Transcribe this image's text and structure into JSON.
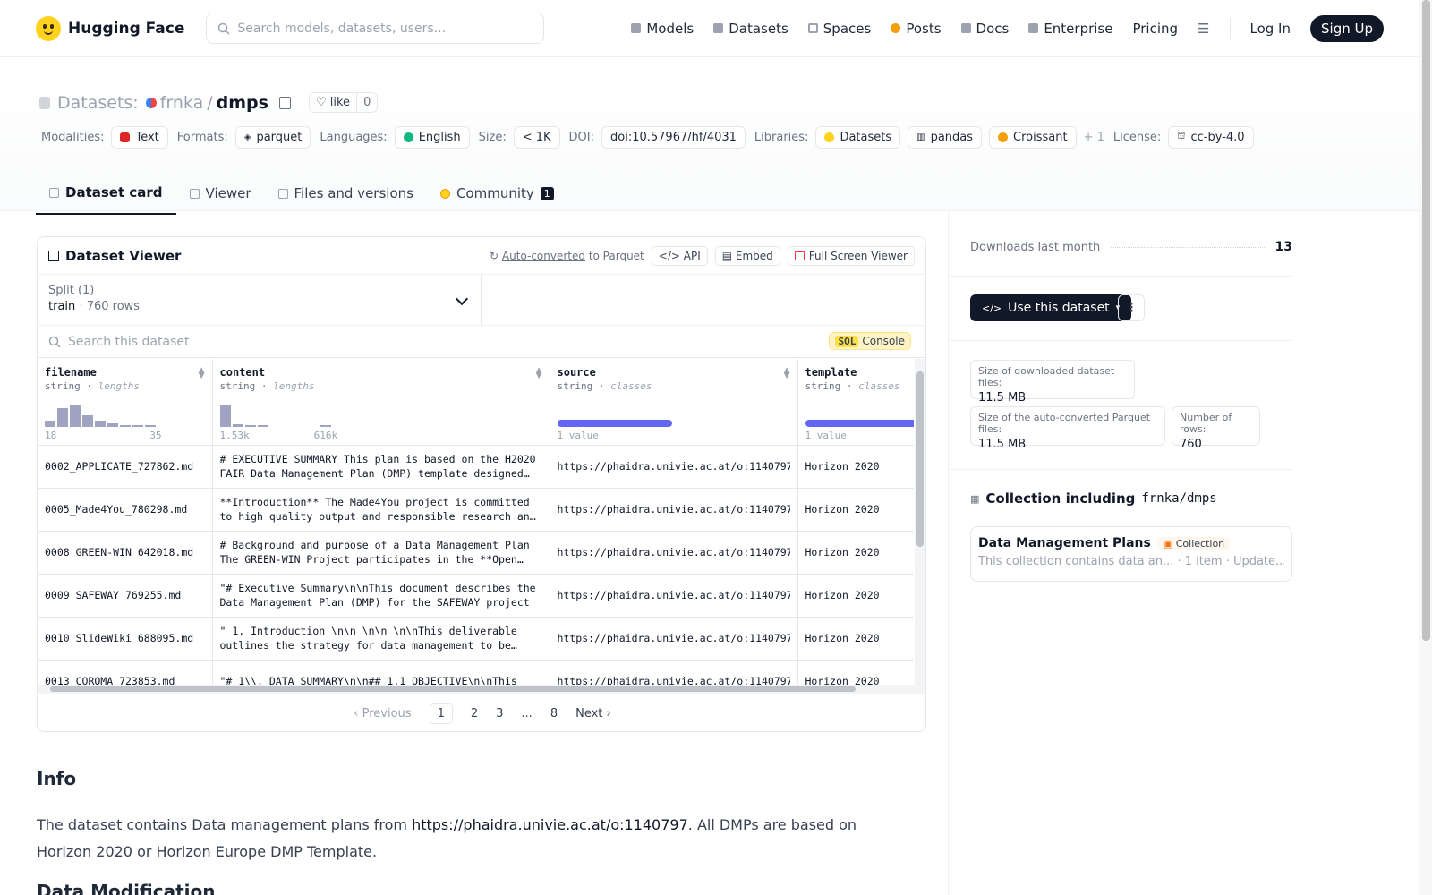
{
  "nav": {
    "brand": "Hugging Face",
    "search_placeholder": "Search models, datasets, users...",
    "links": [
      "Models",
      "Datasets",
      "Spaces",
      "Posts",
      "Docs",
      "Enterprise",
      "Pricing"
    ],
    "login": "Log In",
    "signup": "Sign Up"
  },
  "header": {
    "section": "Datasets:",
    "owner": "frnka",
    "sep": "/",
    "name": "dmps",
    "like_label": "like",
    "like_count": "0"
  },
  "meta": {
    "modalities_label": "Modalities:",
    "modality": "Text",
    "formats_label": "Formats:",
    "format": "parquet",
    "languages_label": "Languages:",
    "language": "English",
    "size_label": "Size:",
    "size": "< 1K",
    "doi_label": "DOI:",
    "doi": "doi:10.57967/hf/4031",
    "libraries_label": "Libraries:",
    "libraries": [
      "Datasets",
      "pandas",
      "Croissant"
    ],
    "libraries_more": "+ 1",
    "license_label": "License:",
    "license": "cc-by-4.0"
  },
  "tabs": [
    "Dataset card",
    "Viewer",
    "Files and versions",
    "Community"
  ],
  "community_count": "1",
  "viewer": {
    "title": "Dataset Viewer",
    "auto_converted": "Auto-converted",
    "to_parquet": " to Parquet",
    "api": "API",
    "embed": "Embed",
    "fullscreen": "Full Screen Viewer",
    "split_label": "Split (1)",
    "split_name": "train",
    "split_rows": "760 rows",
    "search_placeholder": "Search this dataset",
    "sql": "SQL",
    "console": "Console",
    "columns": [
      {
        "name": "filename",
        "type": "string",
        "stat": "lengths",
        "min": "18",
        "max": "35"
      },
      {
        "name": "content",
        "type": "string",
        "stat": "lengths",
        "min": "1.53k",
        "max": "616k"
      },
      {
        "name": "source",
        "type": "string",
        "stat": "classes",
        "summary": "1 value"
      },
      {
        "name": "template",
        "type": "string",
        "stat": "classes",
        "summary": "1 value"
      }
    ],
    "filename_hist": [
      0.25,
      0.75,
      0.85,
      0.45,
      0.22,
      0.12,
      0.07,
      0.05,
      0.04
    ],
    "content_hist": [
      0.85,
      0.1,
      0.06,
      0.03,
      0,
      0,
      0,
      0,
      0.03
    ],
    "rows": [
      {
        "filename": "0002_APPLICATE_727862.md",
        "content": "# EXECUTIVE SUMMARY This plan is based on the H2020 FAIR Data Management Plan (DMP) template designed to be applied to",
        "source": "https://phaidra.univie.ac.at/o:1140797",
        "template": "Horizon 2020"
      },
      {
        "filename": "0005_Made4You_780298.md",
        "content": "**Introduction** The Made4You project is committed to high quality output and responsible research and innovation",
        "source": "https://phaidra.univie.ac.at/o:1140797",
        "template": "Horizon 2020"
      },
      {
        "filename": "0008_GREEN-WIN_642018.md",
        "content": "# Background and purpose of a Data Management Plan The GREEN-WIN Project participates in the **Open Research Data",
        "source": "https://phaidra.univie.ac.at/o:1140797",
        "template": "Horizon 2020"
      },
      {
        "filename": "0009_SAFEWAY_769255.md",
        "content": "\"# Executive Summary\\n\\nThis document describes the Data Management Plan (DMP) for the SAFEWAY project",
        "source": "https://phaidra.univie.ac.at/o:1140797",
        "template": "Horizon 2020"
      },
      {
        "filename": "0010_SlideWiki_688095.md",
        "content": "\" 1. Introduction \\n\\n \\n\\n \\n\\nThis deliverable outlines the strategy for data management to be followed",
        "source": "https://phaidra.univie.ac.at/o:1140797",
        "template": "Horizon 2020"
      },
      {
        "filename": "0013_COROMA_723853.md",
        "content": "\"# 1\\\\. DATA SUMMARY\\n\\n## 1.1 OBJECTIVE\\n\\nThis",
        "source": "https://phaidra.univie.ac.at/o:1140797",
        "template": "Horizon 2020"
      }
    ],
    "pager": {
      "prev": "Previous",
      "pages": [
        "1",
        "2",
        "3",
        "...",
        "8"
      ],
      "next": "Next"
    }
  },
  "info": {
    "heading": "Info",
    "text_before": "The dataset contains Data management plans from ",
    "link": "https://phaidra.univie.ac.at/o:1140797",
    "text_after": ". All DMPs are based on Horizon 2020 or Horizon Europe DMP Template.",
    "heading2": "Data Modification"
  },
  "sidebar": {
    "downloads_label": "Downloads last month",
    "downloads": "13",
    "use_button": "Use this dataset",
    "more": "⋮",
    "size_dl_label": "Size of downloaded dataset files:",
    "size_dl": "11.5 MB",
    "size_parquet_label": "Size of the auto-converted Parquet files:",
    "size_parquet": "11.5 MB",
    "rows_label": "Number of rows:",
    "rows": "760",
    "collection_heading": "Collection including",
    "collection_repo": "frnka/dmps",
    "collection_title": "Data Management Plans",
    "collection_badge": "Collection",
    "collection_sub": "This collection contains data an...  ·  1 item  ·  Update..."
  },
  "colors": {
    "accent": "#FFD21E",
    "dark": "#111827",
    "bar": "#6366f1"
  }
}
